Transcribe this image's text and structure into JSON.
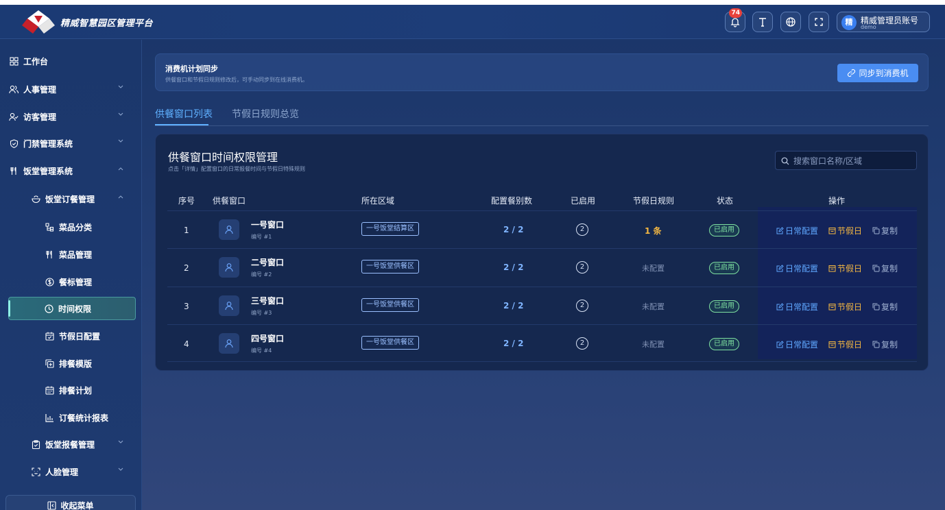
{
  "header": {
    "app_title": "精威智慧园区管理平台",
    "notification_count": "74",
    "user": {
      "avatar_text": "精",
      "name": "精威管理员账号",
      "sub": "demo"
    }
  },
  "sidebar": {
    "items": [
      {
        "label": "工作台",
        "icon": "grid-icon"
      },
      {
        "label": "人事管理",
        "icon": "users-icon"
      },
      {
        "label": "访客管理",
        "icon": "user-check-icon"
      },
      {
        "label": "门禁管理系统",
        "icon": "shield-icon"
      },
      {
        "label": "饭堂管理系统",
        "icon": "fork-knife-icon"
      },
      {
        "label": "饭堂订餐管理",
        "icon": "bowl-icon"
      },
      {
        "label": "菜品分类",
        "icon": "category-icon"
      },
      {
        "label": "菜品管理",
        "icon": "fork-knife-icon"
      },
      {
        "label": "餐标管理",
        "icon": "dollar-circle-icon"
      },
      {
        "label": "时间权限",
        "icon": "clock-icon"
      },
      {
        "label": "节假日配置",
        "icon": "calendar-check-icon"
      },
      {
        "label": "排餐模版",
        "icon": "copy-plus-icon"
      },
      {
        "label": "排餐计划",
        "icon": "calendar-icon"
      },
      {
        "label": "订餐统计报表",
        "icon": "bar-chart-icon"
      },
      {
        "label": "饭堂报餐管理",
        "icon": "clipboard-icon"
      },
      {
        "label": "人脸管理",
        "icon": "face-scan-icon"
      }
    ],
    "collapse_label": "收起菜单"
  },
  "sync": {
    "title": "消费机计划同步",
    "desc": "供餐窗口和节假日规则修改后，可手动同步到在线消费机。",
    "button": "同步到消费机"
  },
  "tabs": [
    {
      "label": "供餐窗口列表"
    },
    {
      "label": "节假日规则总览"
    }
  ],
  "panel": {
    "title": "供餐窗口时间权限管理",
    "subtitle": "点击「详情」配置窗口的日常报餐时间与节假日特殊规则",
    "search_placeholder": "搜索窗口名称/区域",
    "columns": [
      "序号",
      "供餐窗口",
      "所在区域",
      "配置餐别数",
      "已启用",
      "节假日规则",
      "状态",
      "操作"
    ],
    "rows": [
      {
        "index": "1",
        "name": "一号窗口",
        "code": "编号 #1",
        "area": "一号饭堂结算区",
        "meals": "2 / 2",
        "enabled": "2",
        "holiday": "1 条",
        "holiday_set": true,
        "status": "已启用"
      },
      {
        "index": "2",
        "name": "二号窗口",
        "code": "编号 #2",
        "area": "一号饭堂供餐区",
        "meals": "2 / 2",
        "enabled": "2",
        "holiday": "未配置",
        "holiday_set": false,
        "status": "已启用"
      },
      {
        "index": "3",
        "name": "三号窗口",
        "code": "编号 #3",
        "area": "一号饭堂供餐区",
        "meals": "2 / 2",
        "enabled": "2",
        "holiday": "未配置",
        "holiday_set": false,
        "status": "已启用"
      },
      {
        "index": "4",
        "name": "四号窗口",
        "code": "编号 #4",
        "area": "一号饭堂供餐区",
        "meals": "2 / 2",
        "enabled": "2",
        "holiday": "未配置",
        "holiday_set": false,
        "status": "已启用"
      }
    ],
    "actions": {
      "daily": "日常配置",
      "holiday": "节假日",
      "copy": "复制"
    }
  },
  "colors": {
    "accent": "#4a8df2",
    "active_tab": "#5fb0ff",
    "status_green": "#7fe0a0",
    "holiday_orange": "#f5b842",
    "notif_red": "#e8423c"
  }
}
